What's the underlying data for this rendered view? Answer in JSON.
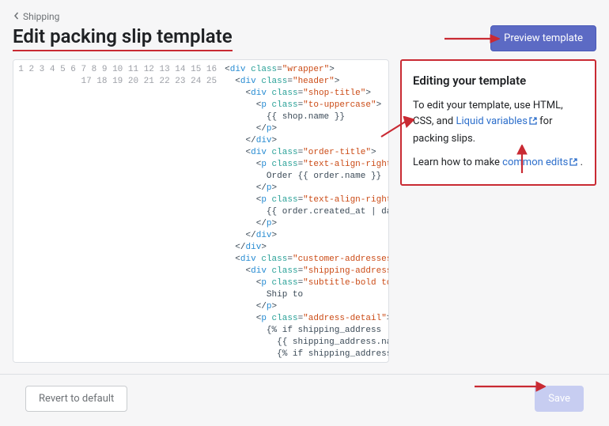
{
  "breadcrumb": {
    "label": "Shipping"
  },
  "page": {
    "title": "Edit packing slip template"
  },
  "actions": {
    "preview": "Preview template",
    "revert": "Revert to default",
    "save": "Save"
  },
  "help": {
    "heading": "Editing your template",
    "p1_a": "To edit your template, use HTML, CSS, and ",
    "p1_link": "Liquid variables",
    "p1_b": " for packing slips.",
    "p2_a": "Learn how to make ",
    "p2_link": "common edits",
    "p2_b": " ."
  },
  "code_lines": [
    {
      "n": 1,
      "i": 0,
      "tag": "div",
      "attr": "class",
      "val": "wrapper",
      "open": true
    },
    {
      "n": 2,
      "i": 1,
      "tag": "div",
      "attr": "class",
      "val": "header",
      "open": true
    },
    {
      "n": 3,
      "i": 2,
      "tag": "div",
      "attr": "class",
      "val": "shop-title",
      "open": true
    },
    {
      "n": 4,
      "i": 3,
      "tag": "p",
      "attr": "class",
      "val": "to-uppercase",
      "open": true
    },
    {
      "n": 5,
      "i": 4,
      "text": "{{ shop.name }}"
    },
    {
      "n": 6,
      "i": 3,
      "close": "p"
    },
    {
      "n": 7,
      "i": 2,
      "close": "div"
    },
    {
      "n": 8,
      "i": 2,
      "tag": "div",
      "attr": "class",
      "val": "order-title",
      "open": true
    },
    {
      "n": 9,
      "i": 3,
      "tag": "p",
      "attr": "class",
      "val": "text-align-right",
      "open": true
    },
    {
      "n": 10,
      "i": 4,
      "text": "Order {{ order.name }}"
    },
    {
      "n": 11,
      "i": 3,
      "close": "p"
    },
    {
      "n": 12,
      "i": 3,
      "tag": "p",
      "attr": "class",
      "val": "text-align-right",
      "open": true
    },
    {
      "n": 13,
      "i": 4,
      "text": "{{ order.created_at | date: \"%B %e, %Y\" }}"
    },
    {
      "n": 14,
      "i": 3,
      "close": "p"
    },
    {
      "n": 15,
      "i": 2,
      "close": "div"
    },
    {
      "n": 16,
      "i": 1,
      "close": "div"
    },
    {
      "n": 17,
      "i": 1,
      "tag": "div",
      "attr": "class",
      "val": "customer-addresses",
      "open": true
    },
    {
      "n": 18,
      "i": 2,
      "tag": "div",
      "attr": "class",
      "val": "shipping-address",
      "open": true
    },
    {
      "n": 19,
      "i": 3,
      "tag": "p",
      "attr": "class",
      "val": "subtitle-bold to-uppercase",
      "open": true
    },
    {
      "n": 20,
      "i": 4,
      "text": "Ship to"
    },
    {
      "n": 21,
      "i": 3,
      "close": "p"
    },
    {
      "n": 22,
      "i": 3,
      "tag": "p",
      "attr": "class",
      "val": "address-detail",
      "open": true
    },
    {
      "n": 23,
      "i": 4,
      "text": "{% if shipping_address != blank %}"
    },
    {
      "n": 24,
      "i": 5,
      "text": "{{ shipping_address.name }}"
    },
    {
      "n": 25,
      "i": 5,
      "text": "{% if shipping_address.company != blank %}"
    }
  ]
}
